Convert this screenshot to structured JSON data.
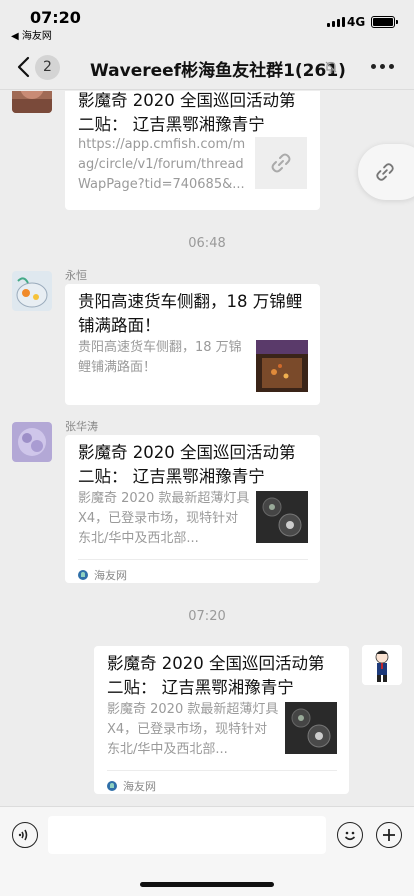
{
  "status_bar": {
    "time": "07:20",
    "back_app": "◀ 海友网",
    "network": "4G"
  },
  "nav": {
    "back_count": "2",
    "title": "Wavereef彬海鱼友社群1(261)"
  },
  "messages": [
    {
      "title": "影魔奇 2020 全国巡回活动第二贴： 辽吉黑鄂湘豫青宁",
      "desc": "https://app.cmfish.com/mag/circle/v1/forum/threadWapPage?tid=740685&..."
    },
    {
      "timestamp": "06:48"
    },
    {
      "sender": "永恒",
      "title": "贵阳高速货车侧翻，18 万锦鲤铺满路面！",
      "desc": "贵阳高速货车侧翻，18 万锦鲤铺满路面！"
    },
    {
      "sender": "张华涛",
      "title": "影魔奇 2020 全国巡回活动第二贴： 辽吉黑鄂湘豫青宁",
      "desc": "影魔奇 2020 款最新超薄灯具 X4，已登录市场，现特针对东北/华中及西北部...",
      "source": "海友网"
    },
    {
      "timestamp": "07:20"
    },
    {
      "title": "影魔奇 2020 全国巡回活动第二贴： 辽吉黑鄂湘豫青宁",
      "desc": "影魔奇 2020 款最新超薄灯具 X4，已登录市场，现特针对东北/华中及西北部...",
      "source": "海友网"
    }
  ],
  "input": {
    "value": ""
  },
  "colors": {
    "background": "#ededed",
    "bubble": "#ffffff",
    "muted_text": "#9a9a9a"
  }
}
